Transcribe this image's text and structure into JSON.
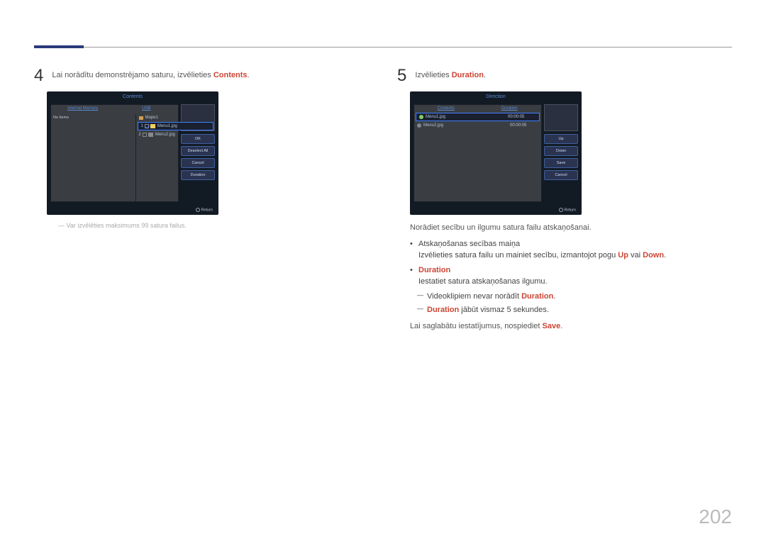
{
  "page_number": "202",
  "left": {
    "step_num": "4",
    "step_text_pre": "Lai norādītu demonstrējamo saturu, izvēlieties ",
    "step_text_hl": "Contents",
    "step_text_post": ".",
    "screen": {
      "title": "Contents",
      "tabs": [
        "Internal Memory",
        "USB"
      ],
      "col1_text": "No Items",
      "folder_label": "Mape1",
      "rows": [
        {
          "idx": "1",
          "name": "Menu1.jpg",
          "selected": true,
          "checked": true
        },
        {
          "idx": "2",
          "name": "Menu2.jpg",
          "selected": false,
          "checked": false
        }
      ],
      "buttons": [
        "OK",
        "Deselect All",
        "Cancel",
        "Duration"
      ],
      "return_label": "Return"
    },
    "footnote": "Var izvēlēties maksimums 99 satura failus."
  },
  "right": {
    "step_num": "5",
    "step_text_pre": "Izvēlieties ",
    "step_text_hl": "Duration",
    "step_text_post": ".",
    "screen": {
      "title": "Direction",
      "headers": [
        "Contents",
        "Duration"
      ],
      "rows": [
        {
          "name": "Menu1.jpg",
          "dur": "00:00:05",
          "selected": true,
          "color": "green"
        },
        {
          "name": "Menu2.jpg",
          "dur": "00:00:05",
          "selected": false,
          "color": "grey"
        }
      ],
      "buttons": [
        "Up",
        "Down",
        "Save",
        "Cancel"
      ],
      "return_label": "Return"
    },
    "body": {
      "line1": "Norādiet secību un ilgumu satura failu atskaņošanai.",
      "b1_title": "Atskaņošanas secības maiņa",
      "b1_body_pre": "Izvēlieties satura failu un mainiet secību, izmantojot pogu ",
      "b1_hl1": "Up",
      "b1_mid": " vai ",
      "b1_hl2": "Down",
      "b1_post": ".",
      "b2_title": "Duration",
      "b2_body": "Iestatiet satura atskaņošanas ilgumu.",
      "b2_d1_pre": "Videoklipiem nevar norādīt ",
      "b2_d1_hl": "Duration",
      "b2_d1_post": ".",
      "b2_d2_hl": "Duration",
      "b2_d2_post": " jābūt vismaz 5 sekundes.",
      "line2_pre": "Lai saglabātu iestatījumus, nospiediet ",
      "line2_hl": "Save",
      "line2_post": "."
    }
  }
}
